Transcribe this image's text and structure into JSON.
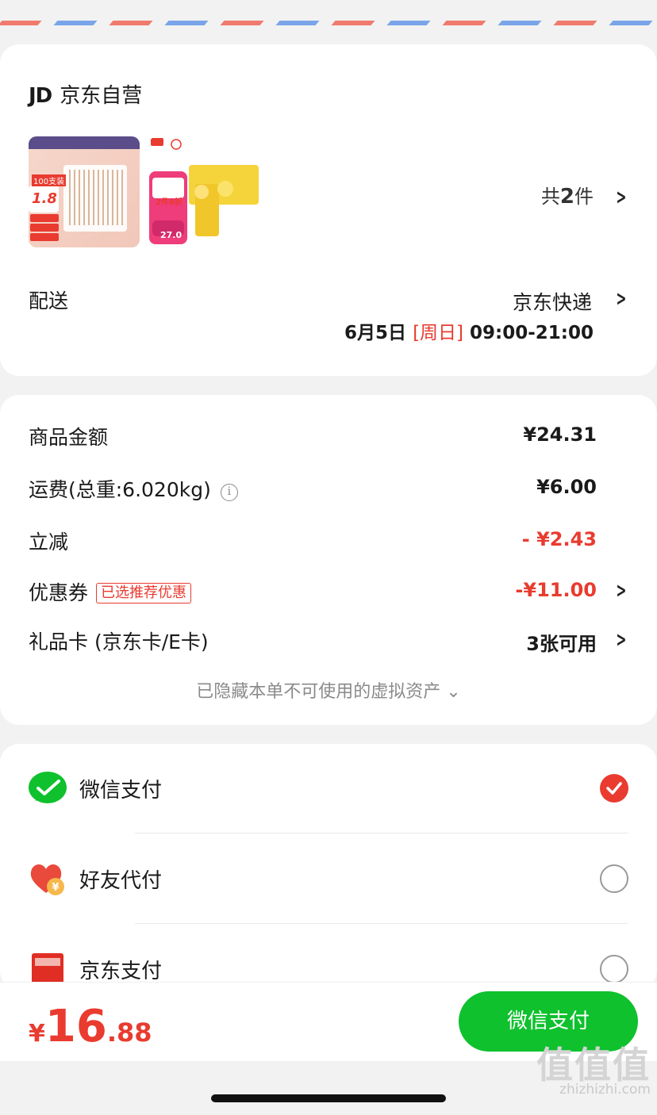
{
  "colors": {
    "accent_red": "#e93b2f",
    "wechat_green": "#0ec12d",
    "airmail_red": "#f07a6e",
    "airmail_blue": "#7aa5e8"
  },
  "shop": {
    "logo": "JD",
    "name": "京东自营",
    "items_prefix": "共",
    "items_count": "2",
    "items_suffix": "件",
    "products": [
      {
        "badge_text": "1.8",
        "desc": "100支装"
      },
      {
        "badge_text": "2件8折",
        "price": "27.0"
      }
    ]
  },
  "delivery": {
    "label": "配送",
    "method": "京东快递",
    "date": "6月5日",
    "weekday": "[周日]",
    "time": "09:00-21:00"
  },
  "price": {
    "goods_label": "商品金额",
    "goods_value": "¥24.31",
    "shipping_label": "运费(总重:6.020kg)",
    "shipping_value": "¥6.00",
    "discount_label": "立减",
    "discount_value": "- ¥2.43",
    "coupon_label": "优惠券",
    "coupon_tag": "已选推荐优惠",
    "coupon_value": "-¥11.00",
    "giftcard_label": "礼品卡 (京东卡/E卡)",
    "giftcard_value": "3张可用",
    "hidden_note": "已隐藏本单不可使用的虚拟资产 ⌄"
  },
  "payment": {
    "methods": [
      {
        "label": "微信支付",
        "icon": "wechat-pay-icon",
        "selected": true
      },
      {
        "label": "好友代付",
        "icon": "friend-pay-heart-icon",
        "selected": false
      },
      {
        "label": "京东支付",
        "icon": "jd-pay-icon",
        "selected": false
      }
    ]
  },
  "footer": {
    "currency": "¥",
    "total_int": "16",
    "total_dec": ".88",
    "pay_button": "微信支付"
  },
  "watermark": {
    "big": "值值值",
    "site": "zhizhizhi.com"
  }
}
